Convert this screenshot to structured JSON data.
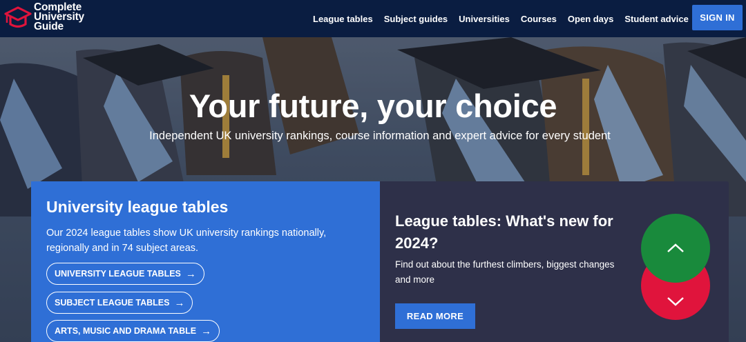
{
  "brand": {
    "line1": "Complete",
    "line2": "University",
    "line3": "Guide",
    "logo_icon": "graduation-cap-icon",
    "accent": "#e0143c"
  },
  "nav": {
    "items": [
      {
        "label": "League tables"
      },
      {
        "label": "Subject guides"
      },
      {
        "label": "Universities"
      },
      {
        "label": "Courses"
      },
      {
        "label": "Open days"
      },
      {
        "label": "Student advice"
      }
    ],
    "signin_label": "SIGN IN"
  },
  "hero": {
    "title": "Your future, your choice",
    "subtitle": "Independent UK university rankings, course information and expert advice for every student"
  },
  "league_card": {
    "title": "University league tables",
    "text": "Our 2024 league tables show UK university rankings nationally, regionally and in 74 subject areas.",
    "links": [
      {
        "label": "UNIVERSITY LEAGUE TABLES",
        "arrow": "→"
      },
      {
        "label": "SUBJECT LEAGUE TABLES",
        "arrow": "→"
      },
      {
        "label": "ARTS, MUSIC AND DRAMA TABLE",
        "arrow": "→"
      }
    ]
  },
  "news_card": {
    "title": "League tables: What's new for 2024?",
    "text": "Find out about the furthest climbers, biggest changes and more",
    "button_label": "READ MORE"
  },
  "scroll": {
    "up_icon": "chevron-up-icon",
    "down_icon": "chevron-down-icon",
    "up_color": "#198a3c",
    "down_color": "#e0143c"
  }
}
